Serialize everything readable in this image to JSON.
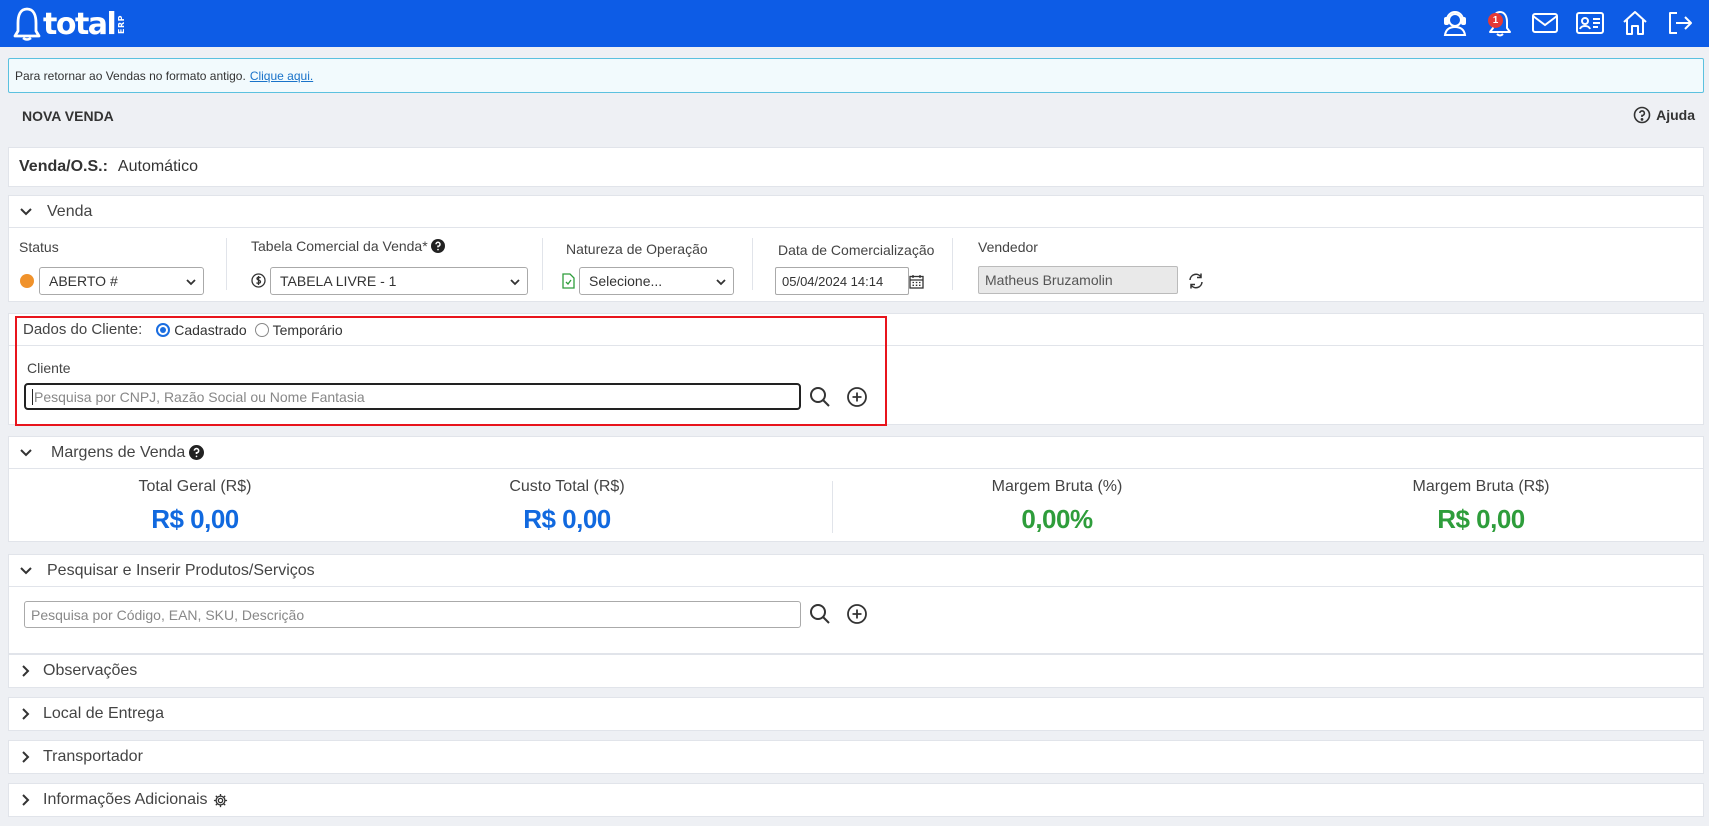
{
  "app": {
    "logo_text": "total",
    "logo_sub": "ERP",
    "notification_count": "1"
  },
  "notice": {
    "text": "Para retornar ao Vendas no formato antigo.",
    "link": "Clique aqui."
  },
  "page": {
    "title": "NOVA VENDA",
    "help_label": "Ajuda"
  },
  "os": {
    "label": "Venda/O.S.:",
    "value": "Automático"
  },
  "venda": {
    "section_title": "Venda",
    "status_label": "Status",
    "status_value": "ABERTO #",
    "status_color": "#f0922b",
    "tabela_label": "Tabela Comercial da Venda*",
    "tabela_value": "TABELA LIVRE - 1",
    "natureza_label": "Natureza de Operação",
    "natureza_value": "Selecione...",
    "data_label": "Data de Comercialização",
    "data_value": "05/04/2024 14:14",
    "vendedor_label": "Vendedor",
    "vendedor_value": "Matheus Bruzamolin"
  },
  "cliente": {
    "section_label": "Dados do Cliente:",
    "option_cadastrado": "Cadastrado",
    "option_temporario": "Temporário",
    "field_label": "Cliente",
    "placeholder": "Pesquisa por CNPJ, Razão Social ou Nome Fantasia"
  },
  "margens": {
    "section_title": "Margens de Venda",
    "total_geral_label": "Total Geral (R$)",
    "total_geral_value": "R$ 0,00",
    "custo_total_label": "Custo Total (R$)",
    "custo_total_value": "R$ 0,00",
    "margem_pct_label": "Margem Bruta (%)",
    "margem_pct_value": "0,00%",
    "margem_rs_label": "Margem Bruta (R$)",
    "margem_rs_value": "R$ 0,00"
  },
  "produtos": {
    "section_title": "Pesquisar e Inserir Produtos/Serviços",
    "placeholder": "Pesquisa por Código, EAN, SKU, Descrição"
  },
  "sections": {
    "observacoes": "Observações",
    "local_entrega": "Local de Entrega",
    "transportador": "Transportador",
    "info_adicionais": "Informações Adicionais"
  }
}
